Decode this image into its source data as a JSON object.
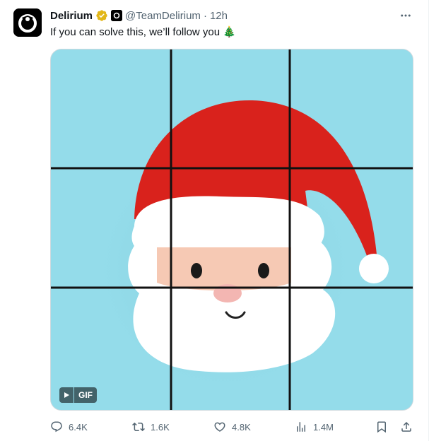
{
  "account": {
    "name": "Delirium",
    "handle": "@TeamDelirium",
    "separator": "·",
    "time": "12h",
    "verified_color": "#e2b719"
  },
  "tweet": {
    "text": "If you can solve this, we’ll follow you 🎄"
  },
  "media": {
    "gif_label": "GIF",
    "background_color": "#94dcea",
    "hat_color": "#d9221c",
    "grid": "3x3"
  },
  "actions": {
    "replies": "6.4K",
    "retweets": "1.6K",
    "likes": "4.8K",
    "views": "1.4M"
  },
  "icons": [
    "more-icon",
    "verified-icon",
    "reply-icon",
    "retweet-icon",
    "like-icon",
    "views-icon",
    "bookmark-icon",
    "share-icon",
    "play-icon"
  ]
}
